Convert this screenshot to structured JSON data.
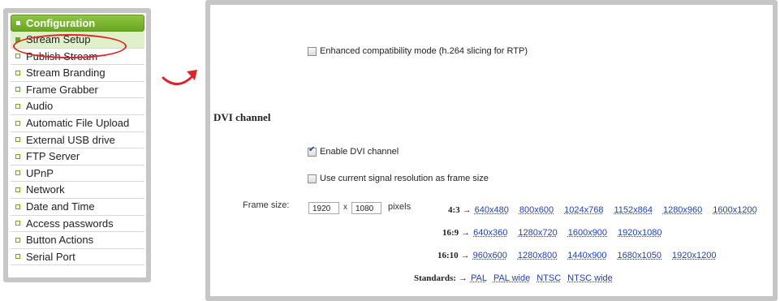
{
  "sidebar": {
    "header": "Configuration",
    "items": [
      {
        "label": "Stream Setup",
        "active": true
      },
      {
        "label": "Publish Stream"
      },
      {
        "label": "Stream Branding"
      },
      {
        "label": "Frame Grabber"
      },
      {
        "label": "Audio"
      },
      {
        "label": "Automatic File Upload"
      },
      {
        "label": "External USB drive"
      },
      {
        "label": "FTP Server"
      },
      {
        "label": "UPnP"
      },
      {
        "label": "Network"
      },
      {
        "label": "Date and Time"
      },
      {
        "label": "Access passwords"
      },
      {
        "label": "Button Actions"
      },
      {
        "label": "Serial Port"
      }
    ]
  },
  "main": {
    "enhanced_compat_label": "Enhanced compatibility mode (h.264 slicing for RTP)",
    "section_title": "DVI channel",
    "enable_dvi_label": "Enable DVI channel",
    "use_current_label": "Use current signal resolution as frame size",
    "frame_size_label": "Frame size:",
    "width_value": "1920",
    "height_value": "1080",
    "x_sep": "x",
    "units": "pixels",
    "ratios": [
      {
        "label": "4:3",
        "links": [
          "640x480",
          "800x600",
          "1024x768",
          "1152x864",
          "1280x960",
          "1600x1200"
        ]
      },
      {
        "label": "16:9",
        "links": [
          "640x360",
          "1280x720",
          "1600x900",
          "1920x1080"
        ]
      },
      {
        "label": "16:10",
        "links": [
          "960x600",
          "1280x800",
          "1440x900",
          "1680x1050",
          "1920x1200"
        ]
      },
      {
        "label": "Standards:",
        "links": [
          "PAL",
          "PAL wide",
          "NTSC",
          "NTSC wide"
        ]
      }
    ],
    "arrow": "→"
  },
  "colors": {
    "accent": "#6aa624",
    "highlight": "#d9262c",
    "link": "#1e3fb8"
  }
}
